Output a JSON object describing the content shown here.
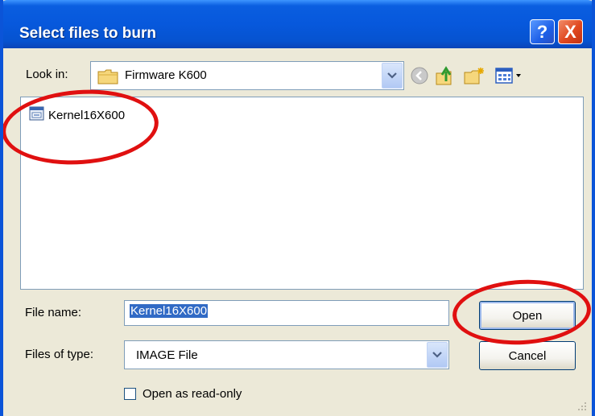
{
  "window": {
    "title": "Select files to burn"
  },
  "titlebar_buttons": {
    "help": "?",
    "close": "X"
  },
  "lookin": {
    "label": "Look in:",
    "value": "Firmware K600"
  },
  "toolbar": {
    "icons": [
      "back-icon",
      "up-folder-icon",
      "new-folder-icon",
      "view-menu-icon"
    ]
  },
  "files": [
    {
      "name": "Kernel16X600",
      "icon": "image-file-icon"
    }
  ],
  "form": {
    "file_name_label": "File name:",
    "file_name_value": "Kernel16X600",
    "file_type_label": "Files of type:",
    "file_type_value": "IMAGE File",
    "readonly_label": "Open as read-only",
    "readonly_checked": false
  },
  "buttons": {
    "open": "Open",
    "cancel": "Cancel"
  },
  "colors": {
    "titlebar": "#0758dc",
    "window_face": "#ece9d8",
    "selection": "#316ac5",
    "annotation": "#e01010"
  }
}
